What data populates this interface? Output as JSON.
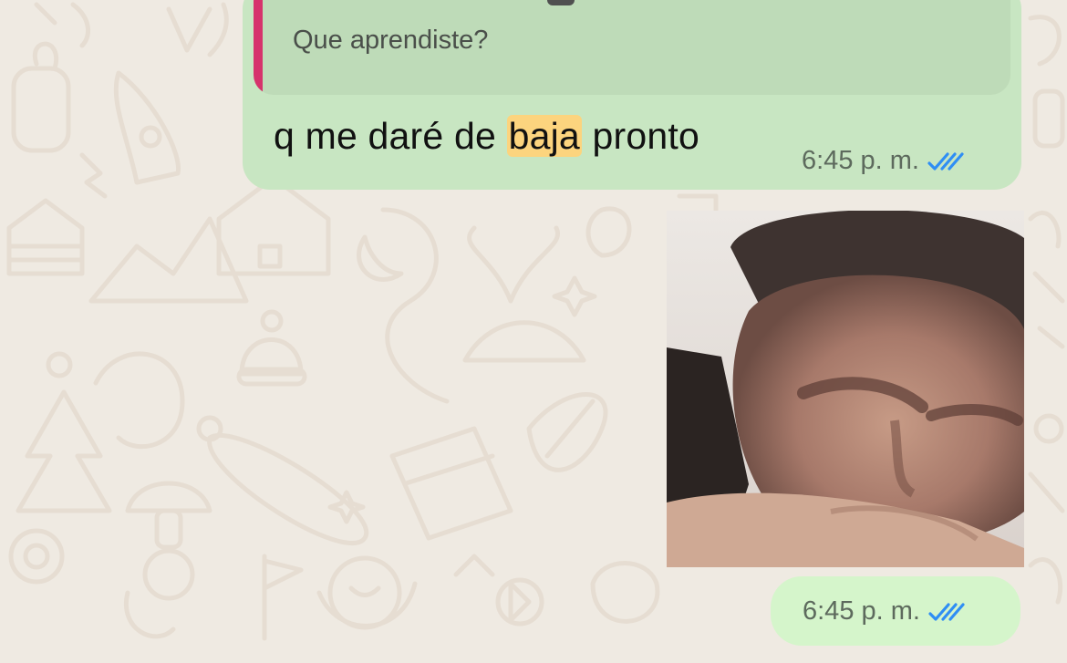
{
  "chat": {
    "messages": [
      {
        "type": "text",
        "quoted": {
          "text": "Que aprendiste?"
        },
        "body_before": "q me daré de ",
        "body_highlight": "baja",
        "body_after": " pronto",
        "time": "6:45 p. m.",
        "status_icon": "double-check-icon"
      },
      {
        "type": "image",
        "time": "6:45 p. m.",
        "status_icon": "double-check-icon"
      }
    ]
  },
  "colors": {
    "wallpaper": "#efeae2",
    "outgoing_bubble": "#c8e6c2",
    "quote_bar": "#d6336c",
    "highlight": "#fcd47e",
    "read_check": "#2f8ef4"
  }
}
